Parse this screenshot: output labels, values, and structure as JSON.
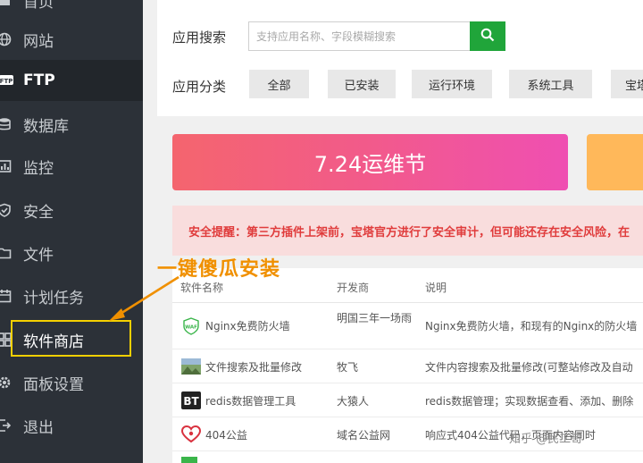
{
  "sidebar": {
    "items": [
      {
        "label": "首页",
        "icon": "home-icon"
      },
      {
        "label": "网站",
        "icon": "globe-icon"
      },
      {
        "label": "FTP",
        "icon": "ftp-icon"
      },
      {
        "label": "数据库",
        "icon": "database-icon"
      },
      {
        "label": "监控",
        "icon": "monitor-icon"
      },
      {
        "label": "安全",
        "icon": "shield-icon"
      },
      {
        "label": "文件",
        "icon": "folder-icon"
      },
      {
        "label": "计划任务",
        "icon": "calendar-icon"
      },
      {
        "label": "软件商店",
        "icon": "grid-icon"
      },
      {
        "label": "面板设置",
        "icon": "gear-icon"
      },
      {
        "label": "退出",
        "icon": "logout-icon"
      }
    ]
  },
  "annotation": {
    "text": "一键傻瓜安装",
    "color": "#f09000"
  },
  "search": {
    "label": "应用搜索",
    "placeholder": "支持应用名称、字段模糊搜索"
  },
  "categories": {
    "label": "应用分类",
    "items": [
      "全部",
      "已安装",
      "运行环境",
      "系统工具",
      "宝塔"
    ]
  },
  "banner": {
    "text": "7.24运维节"
  },
  "warning": {
    "text": "安全提醒：第三方插件上架前，宝塔官方进行了安全审计，但可能还存在安全风险，在"
  },
  "table": {
    "headers": [
      "软件名称",
      "开发商",
      "说明"
    ],
    "rows": [
      {
        "name": "Nginx免费防火墙",
        "vendor": "明国三年一场雨",
        "desc": "Nginx免费防火墙，和现有的Nginx的防火墙",
        "icon": "waf-icon"
      },
      {
        "name": "文件搜索及批量修改",
        "vendor": "牧飞",
        "desc": "文件内容搜索及批量修改(可整站修改及自动",
        "icon": "image-icon"
      },
      {
        "name": "redis数据管理工具",
        "vendor": "大猿人",
        "desc": "redis数据管理；实现数据查看、添加、删除",
        "icon": "bt-icon"
      },
      {
        "name": "404公益",
        "vendor": "域名公益网",
        "desc": "响应式404公益代码，页面内容同时",
        "icon": "heart-icon"
      }
    ]
  },
  "watermark": {
    "text": "知乎 @民工哥"
  }
}
